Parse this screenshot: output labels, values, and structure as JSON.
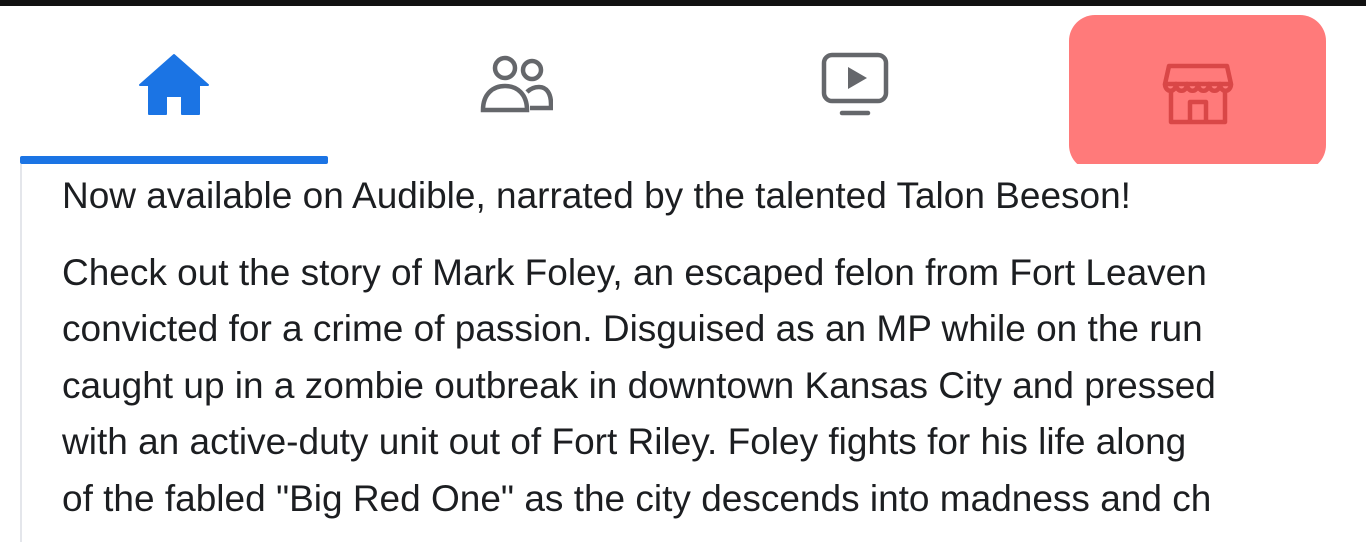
{
  "nav": {
    "tabs": [
      {
        "name": "home",
        "icon": "home-icon",
        "active": true
      },
      {
        "name": "friends",
        "icon": "friends-icon",
        "active": false
      },
      {
        "name": "watch",
        "icon": "watch-icon",
        "active": false
      },
      {
        "name": "marketplace",
        "icon": "marketplace-icon",
        "active": false,
        "highlighted": true
      }
    ]
  },
  "colors": {
    "accent": "#1b74e4",
    "icon_inactive": "#65676b",
    "highlight": "#ff7a7a",
    "text": "#1c1e21"
  },
  "post": {
    "lead": "Now available on Audible, narrated by the talented Talon Beeson!",
    "body_lines": [
      "Check out the story of Mark Foley, an escaped felon from Fort Leaven",
      "convicted for a crime of passion. Disguised as an MP while on the run",
      "caught up in a zombie outbreak in downtown Kansas City and pressed",
      "with an active-duty unit out of Fort Riley. Foley fights for his life along",
      "of the fabled \"Big Red One\" as the city descends into madness and ch"
    ]
  }
}
